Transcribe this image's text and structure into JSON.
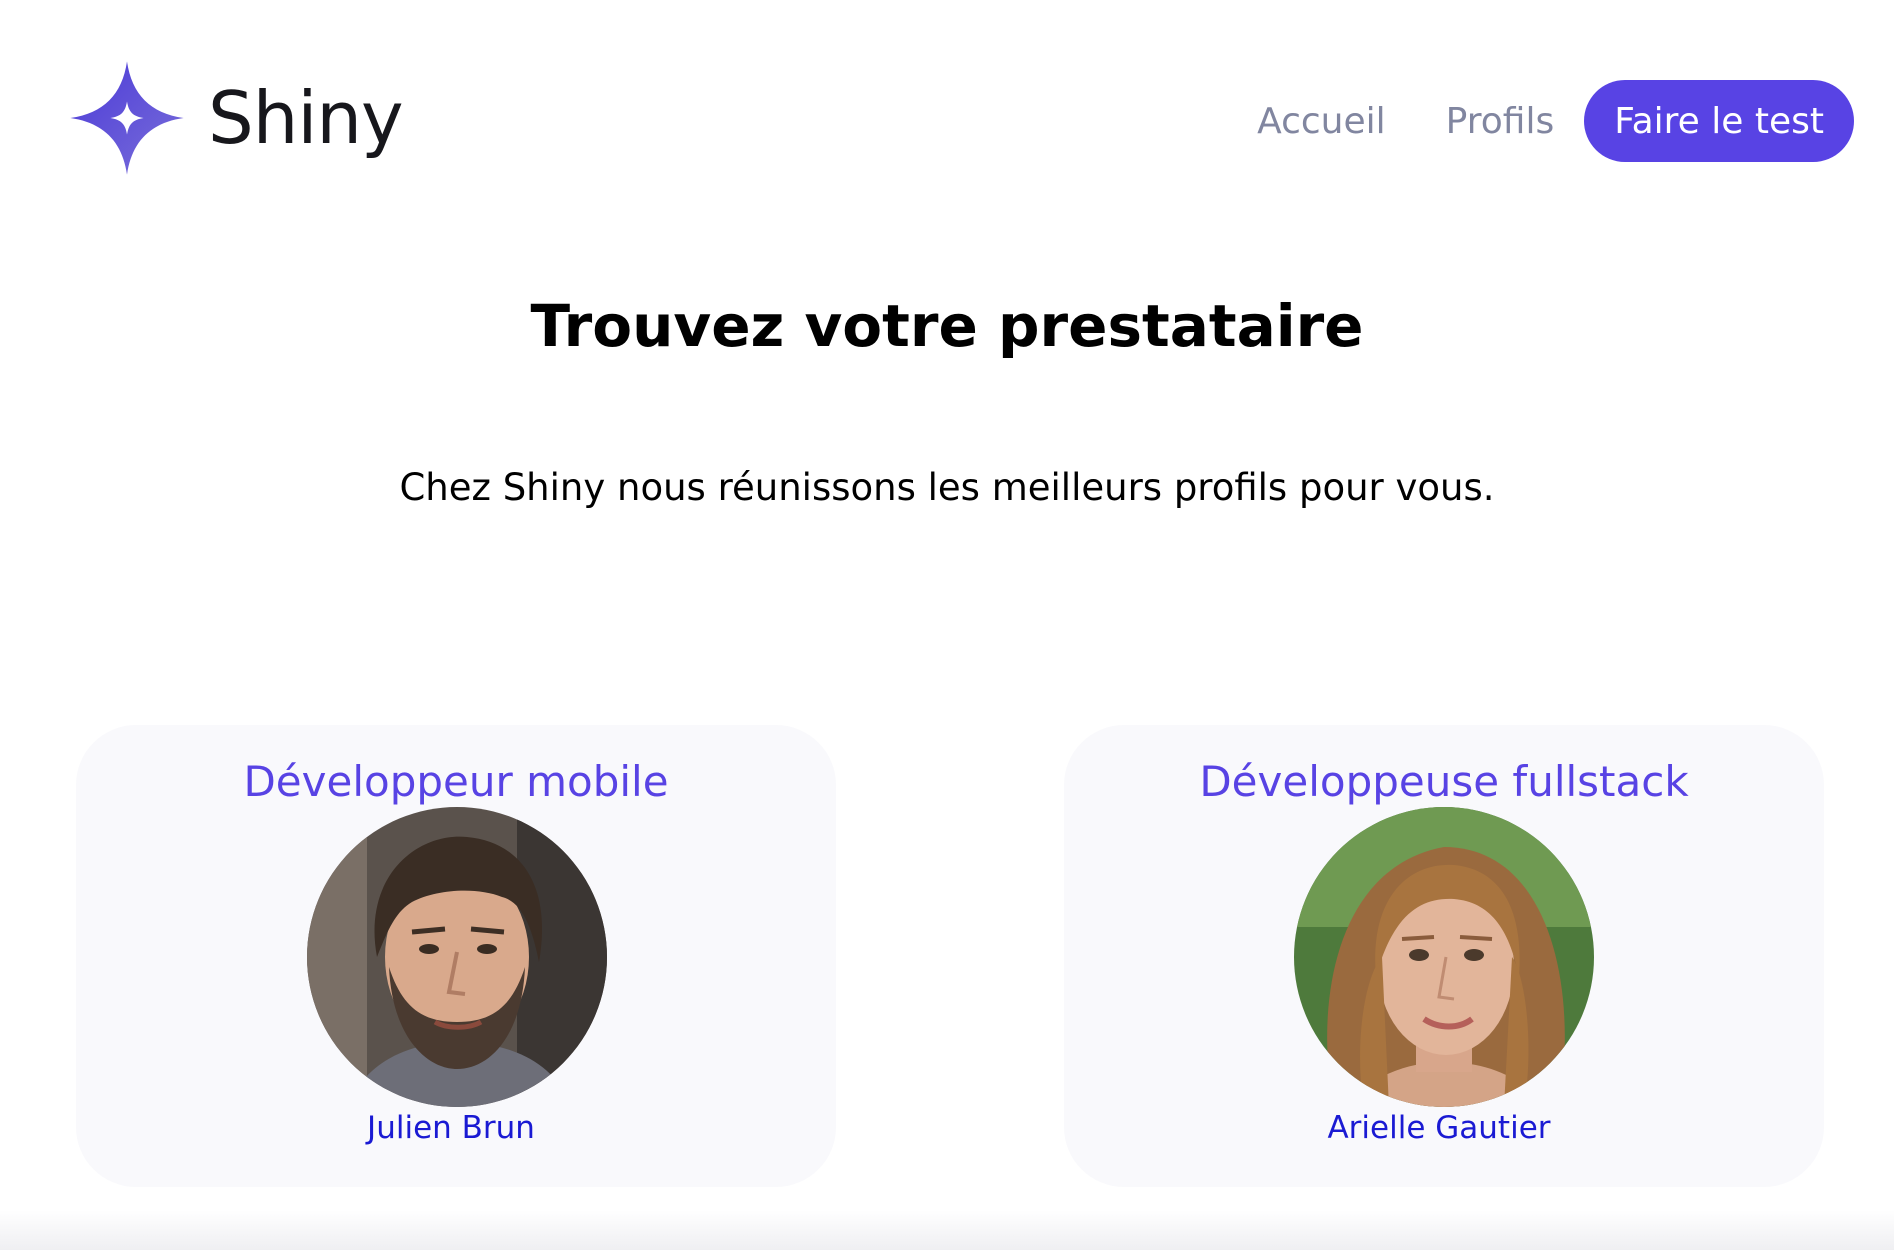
{
  "brand": {
    "name": "Shiny",
    "logo_icon": "star-sparkle-icon",
    "logo_colors": [
      "#5843e4",
      "#6b5cd6"
    ]
  },
  "nav": {
    "home_label": "Accueil",
    "profiles_label": "Profils",
    "cta_label": "Faire le test",
    "cta_color": "#5843e4",
    "link_color": "#8186a0"
  },
  "hero": {
    "title": "Trouvez votre prestataire",
    "subtitle": "Chez Shiny nous réunissons les meilleurs profils pour vous."
  },
  "profiles": [
    {
      "job": "Développeur mobile",
      "name": "Julien Brun",
      "avatar": "profile-photo-man"
    },
    {
      "job": "Développeuse fullstack",
      "name": "Arielle Gautier",
      "avatar": "profile-photo-woman"
    }
  ],
  "colors": {
    "accent": "#5843e4",
    "card_background": "#f9f9fc",
    "name_color": "#1a1ad3"
  }
}
